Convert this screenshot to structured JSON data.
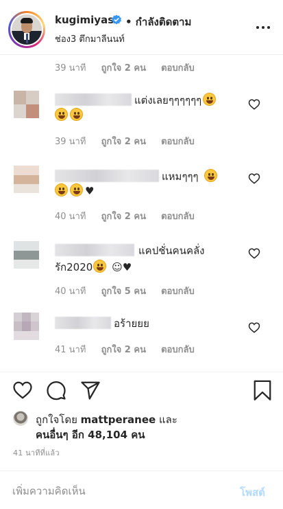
{
  "header": {
    "username": "kugimiyas",
    "follow_status": "• กำลังติดตาม",
    "location": "ช่อง3 ตึกมาลีนนท์"
  },
  "comments": [
    {
      "text": "",
      "emoji_line": "",
      "time": "39 นาที",
      "likes": "ถูกใจ 2 คน",
      "reply": "ตอบกลับ"
    },
    {
      "text": "แต่งเลยๆๆๆๆๆๆ",
      "emoji_line": "",
      "time": "39 นาที",
      "likes": "ถูกใจ 2 คน",
      "reply": "ตอบกลับ"
    },
    {
      "text": "แหมๆๆๆ",
      "emoji_line": "♥",
      "time": "40 นาที",
      "likes": "ถูกใจ 2 คน",
      "reply": "ตอบกลับ"
    },
    {
      "text": "แคปชั่นคนคลั่ง",
      "line2": "รัก2020",
      "emoji_line": "☺♥",
      "time": "40 นาที",
      "likes": "ถูกใจ 5 คน",
      "reply": "ตอบกลับ"
    },
    {
      "text": "อร้ายยย",
      "emoji_line": "",
      "time": "41 นาที",
      "likes": "ถูกใจ 2 คน",
      "reply": "ตอบกลับ"
    }
  ],
  "likes_summary": {
    "prefix": "ถูกใจโดย",
    "user": "mattperanee",
    "conj": "และ",
    "others": "คนอื่นๆ อีก 48,104 คน"
  },
  "posted_time": "41 นาทีที่แล้ว",
  "add_comment": {
    "placeholder": "เพิ่มความคิดเห็น",
    "post_label": "โพสต์"
  },
  "colors": {
    "text": "#262626",
    "secondary": "#8e8e8e",
    "verified": "#3897f0",
    "post_disabled": "#b3dbff"
  },
  "icons": [
    "verified-badge-icon",
    "more-options-icon",
    "heart-outline-icon",
    "comment-icon",
    "share-icon",
    "bookmark-icon"
  ]
}
